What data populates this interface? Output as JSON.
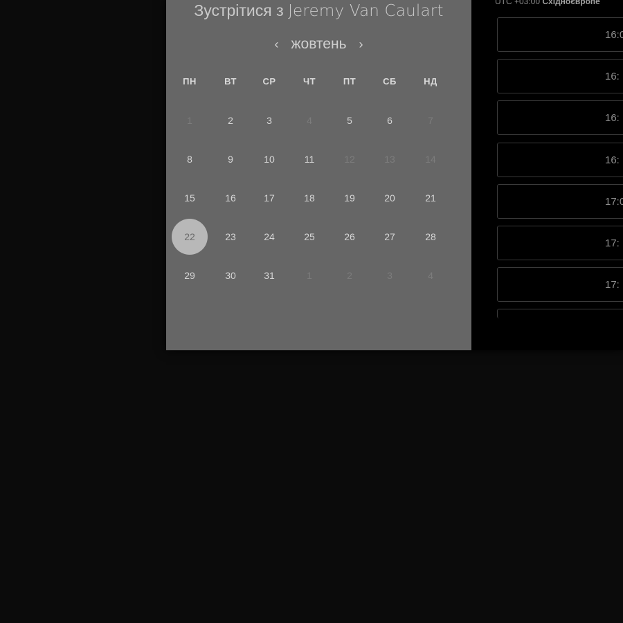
{
  "calendar": {
    "title_prefix": "Зустрітися з",
    "host_name": "Jeremy Van Caulart",
    "month": "жовтень",
    "prev_icon": "‹",
    "next_icon": "›",
    "weekdays": [
      "ПН",
      "ВТ",
      "СР",
      "ЧТ",
      "ПТ",
      "СБ",
      "НД"
    ],
    "weeks": [
      [
        "1",
        "2",
        "3",
        "4",
        "5",
        "6",
        "7"
      ],
      [
        "8",
        "9",
        "10",
        "11",
        "12",
        "13",
        "14"
      ],
      [
        "15",
        "16",
        "17",
        "18",
        "19",
        "20",
        "21"
      ],
      [
        "22",
        "23",
        "24",
        "25",
        "26",
        "27",
        "28"
      ],
      [
        "29",
        "30",
        "31",
        "1",
        "2",
        "3",
        "4"
      ]
    ],
    "selected_day": "22"
  },
  "slots": {
    "timezone_offset": "UTC +03:00",
    "timezone_name": "Східноєвропе",
    "items": [
      "16:0",
      "16:",
      "16:",
      "16:",
      "17:0",
      "17:",
      "17:"
    ]
  },
  "colors": {
    "calendar_bg": "#666666",
    "slots_bg": "#000000",
    "page_bg": "#0b0b0b",
    "selected_day_bg": "#b8b8b8"
  }
}
